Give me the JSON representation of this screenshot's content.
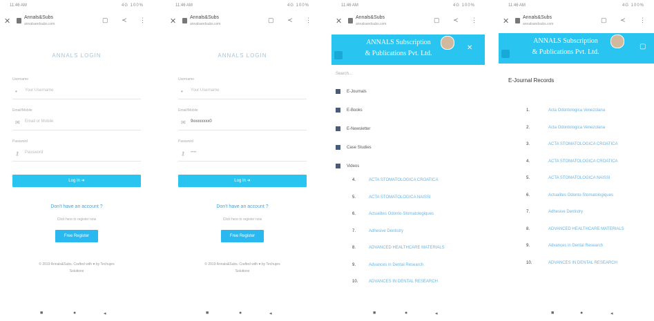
{
  "status": {
    "time": "11:46 AM",
    "icons": "4G 100%"
  },
  "browser": {
    "site": "Annals&Subs",
    "domain": "annalsandsubs.com"
  },
  "login": {
    "title": "ANNALS LOGIN",
    "user_label": "Username",
    "user_placeholder": "Your Username",
    "email_label": "Email/Mobile",
    "email_placeholder": "Email or Mobile",
    "email_value": "9xxxxxxxx0",
    "pass_label": "Password",
    "pass_placeholder": "Password",
    "pass_value": "••••",
    "login_button": "Log In ➜",
    "no_account": "Don't have an account ?",
    "register_hint": "Click here to register now",
    "register_button": "Free Register",
    "footer_1": "© 2019 Annals&Subs. Crafted with ♥ by Techuprs",
    "footer_2": "Solutions"
  },
  "drawer": {
    "brand_line1": "ANNALS Subscription",
    "brand_line2": "& Publications Pvt. Ltd.",
    "search": "Search...",
    "items": [
      "E-Journals",
      "E-Books",
      "E-Newsletter",
      "Case Studies",
      "Videos"
    ],
    "list": [
      {
        "n": "4.",
        "t": "ACTA STOMATOLOGICA CROATICA"
      },
      {
        "n": "5.",
        "t": "ACTA STOMATOLOGICA NAISSI"
      },
      {
        "n": "6.",
        "t": "Actualites Odonto-Stomatologiques"
      },
      {
        "n": "7.",
        "t": "Adhesive Dentistry"
      },
      {
        "n": "8.",
        "t": "ADVANCED HEALTHCARE MATERIALS"
      },
      {
        "n": "9.",
        "t": "Advances in Dental Research"
      },
      {
        "n": "10.",
        "t": "ADVANCES IN DENTAL RESEARCH"
      }
    ]
  },
  "ejournal": {
    "heading": "E-Journal Records",
    "list": [
      {
        "n": "1.",
        "t": "Acta Odontologica Venezolana"
      },
      {
        "n": "2.",
        "t": "Acta Odontologica Venezolana"
      },
      {
        "n": "3.",
        "t": "ACTA STOMATOLOGICA CROATICA"
      },
      {
        "n": "4.",
        "t": "ACTA STOMATOLOGICA CROATICA"
      },
      {
        "n": "5.",
        "t": "ACTA STOMATOLOGICA NAISSI"
      },
      {
        "n": "6.",
        "t": "Actualites Odonto-Stomatologiques"
      },
      {
        "n": "7.",
        "t": "Adhesive Dentistry"
      },
      {
        "n": "8.",
        "t": "ADVANCED HEALTHCARE MATERIALS"
      },
      {
        "n": "9.",
        "t": "Advances in Dental Research"
      },
      {
        "n": "10.",
        "t": "ADVANCES IN DENTAL RESEARCH"
      }
    ]
  },
  "nav": {
    "back": "◂",
    "home": "●",
    "recent": "■"
  },
  "colors": {
    "accent": "#29c4ef",
    "link": "#6ab4e6"
  }
}
